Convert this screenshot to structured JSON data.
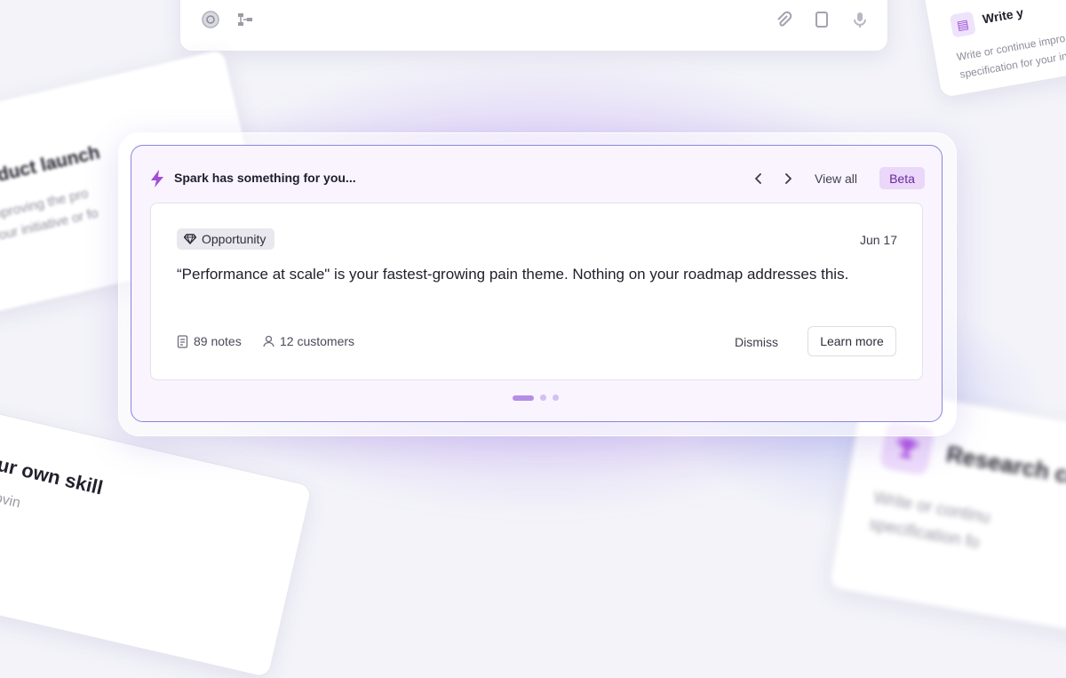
{
  "background": {
    "top_bar_icons": [
      "at-icon",
      "flow-icon",
      "paperclip-icon",
      "tablet-icon",
      "mic-icon"
    ],
    "left_card": {
      "title": "roduct launch",
      "text_lines": [
        "improving the pro",
        "your initiative or fo"
      ]
    },
    "bottom_left_card": {
      "title": "ur own skill",
      "text": "rovin"
    },
    "top_right_card": {
      "title": "Write y",
      "text_lines": [
        "Write or continue impro",
        "specification for your in"
      ]
    },
    "bottom_right_card": {
      "title": "Research ca",
      "text_lines": [
        "Write or continu",
        "specification fo"
      ]
    }
  },
  "spark": {
    "title": "Spark has something for you...",
    "prev_label": "‹",
    "next_label": "›",
    "view_all_label": "View all",
    "beta_label": "Beta",
    "accent_color": "#8b86dc"
  },
  "card": {
    "tag_label": "Opportunity",
    "date": "Jun 17",
    "message": "“Performance at scale\" is your fastest-growing pain theme. Nothing on your roadmap addresses this.",
    "notes_label": "89 notes",
    "customers_label": "12 customers",
    "dismiss_label": "Dismiss",
    "learn_more_label": "Learn more"
  },
  "pagination": {
    "count": 3,
    "active_index": 0
  }
}
